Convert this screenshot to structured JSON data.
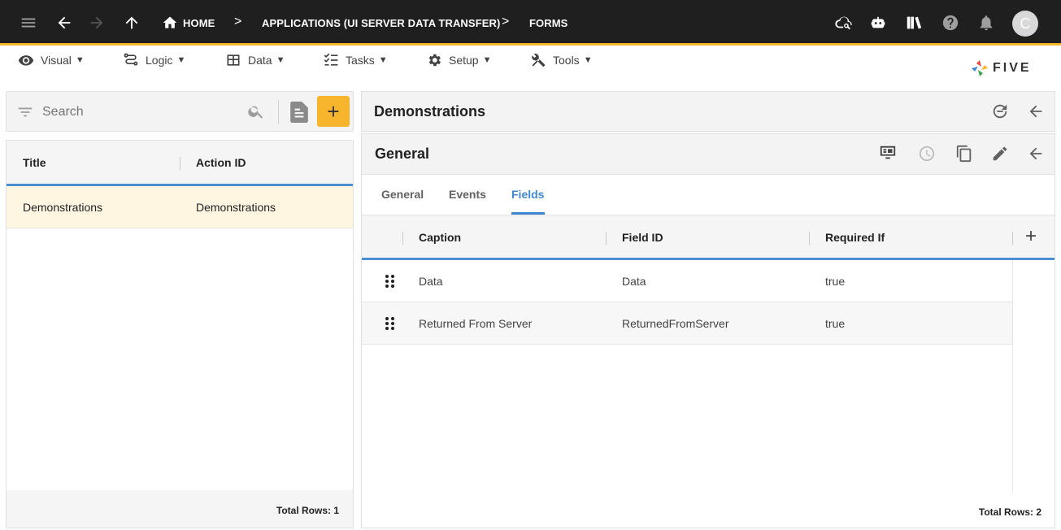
{
  "topbar": {
    "breadcrumbs": [
      "HOME",
      "APPLICATIONS (UI SERVER DATA TRANSFER)",
      "FORMS"
    ],
    "separator": ">",
    "avatar_letter": "C"
  },
  "menu": {
    "items": [
      {
        "label": "Visual",
        "icon": "eye-icon"
      },
      {
        "label": "Logic",
        "icon": "logic-icon"
      },
      {
        "label": "Data",
        "icon": "table-icon"
      },
      {
        "label": "Tasks",
        "icon": "checklist-icon"
      },
      {
        "label": "Setup",
        "icon": "gear-icon"
      },
      {
        "label": "Tools",
        "icon": "tools-icon"
      }
    ],
    "caret": "▼",
    "logo_text": "FIVE"
  },
  "left": {
    "search_placeholder": "Search",
    "add_label": "+",
    "columns": [
      "Title",
      "Action ID"
    ],
    "rows": [
      {
        "title": "Demonstrations",
        "action_id": "Demonstrations"
      }
    ],
    "total_rows": "Total Rows: 1"
  },
  "right": {
    "title": "Demonstrations",
    "section_title": "General",
    "tabs": [
      "General",
      "Events",
      "Fields"
    ],
    "active_tab": "Fields",
    "columns": [
      "Caption",
      "Field ID",
      "Required If"
    ],
    "add_label": "+",
    "rows": [
      {
        "caption": "Data",
        "field_id": "Data",
        "required_if": "true"
      },
      {
        "caption": "Returned From Server",
        "field_id": "ReturnedFromServer",
        "required_if": "true"
      }
    ],
    "total_rows": "Total Rows: 2"
  },
  "colors": {
    "topbar_bg": "#1f1f1f",
    "accent": "#f5b82e",
    "selected_row": "#fff6e2",
    "active_tab": "#3f88d1"
  }
}
